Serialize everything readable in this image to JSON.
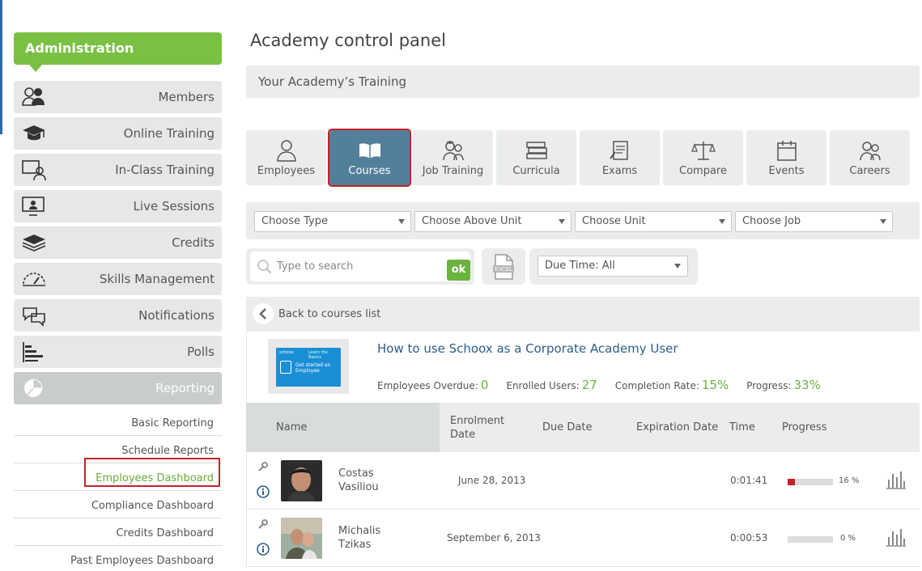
{
  "sidebar": {
    "header": "Administration",
    "items": [
      {
        "label": "Members",
        "icon": "members-icon"
      },
      {
        "label": "Online Training",
        "icon": "graduation-cap-icon"
      },
      {
        "label": "In-Class Training",
        "icon": "classroom-icon"
      },
      {
        "label": "Live Sessions",
        "icon": "live-session-icon"
      },
      {
        "label": "Credits",
        "icon": "credits-icon"
      },
      {
        "label": "Skills Management",
        "icon": "gauge-icon"
      },
      {
        "label": "Notifications",
        "icon": "notifications-icon"
      },
      {
        "label": "Polls",
        "icon": "polls-icon"
      },
      {
        "label": "Reporting",
        "icon": "reporting-icon"
      }
    ],
    "submenu": [
      "Basic Reporting",
      "Schedule Reports",
      "Employees Dashboard",
      "Compliance Dashboard",
      "Credits Dashboard",
      "Past Employees Dashboard"
    ]
  },
  "main": {
    "title": "Academy control panel",
    "section": "Your Academy’s Training",
    "tabs": [
      "Employees",
      "Courses",
      "Job Training",
      "Curricula",
      "Exams",
      "Compare",
      "Events",
      "Careers"
    ],
    "filters": [
      "Choose Type",
      "Choose Above Unit",
      "Choose Unit",
      "Choose Job"
    ],
    "search_placeholder": "Type to search",
    "ok_label": "ok",
    "excel_label": "EXCEL",
    "due_time": "Due Time: All",
    "back_label": "Back to courses list"
  },
  "course": {
    "title": "How to use Schoox as a Corporate Academy User",
    "thumb_brand": "schoox",
    "thumb_tag": "Learn the Basics",
    "thumb_text": "Get started as Employee",
    "stats": [
      {
        "label": "Employees Overdue:",
        "value": "0"
      },
      {
        "label": "Enrolled Users:",
        "value": "27"
      },
      {
        "label": "Completion Rate:",
        "value": "15%"
      },
      {
        "label": "Progress:",
        "value": "33%"
      }
    ]
  },
  "table": {
    "headers": {
      "name": "Name",
      "enrolment_1": "Enrolment",
      "enrolment_2": "Date",
      "due": "Due Date",
      "expiration": "Expiration Date",
      "time": "Time",
      "progress": "Progress"
    },
    "rows": [
      {
        "first": "Costas",
        "last": "Vasiliou",
        "enrolment": "June 28, 2013",
        "time": "0:01:41",
        "progress": 0.16,
        "progress_label": "16 %"
      },
      {
        "first": "Michalis",
        "last": "Tzikas",
        "enrolment": "September 6, 2013",
        "time": "0:00:53",
        "progress": 0.0,
        "progress_label": "0 %"
      }
    ]
  },
  "colors": {
    "accent_green": "#7ac143",
    "tab_active": "#52809b",
    "highlight_red": "#c8202a",
    "link_blue": "#2c5e88"
  }
}
